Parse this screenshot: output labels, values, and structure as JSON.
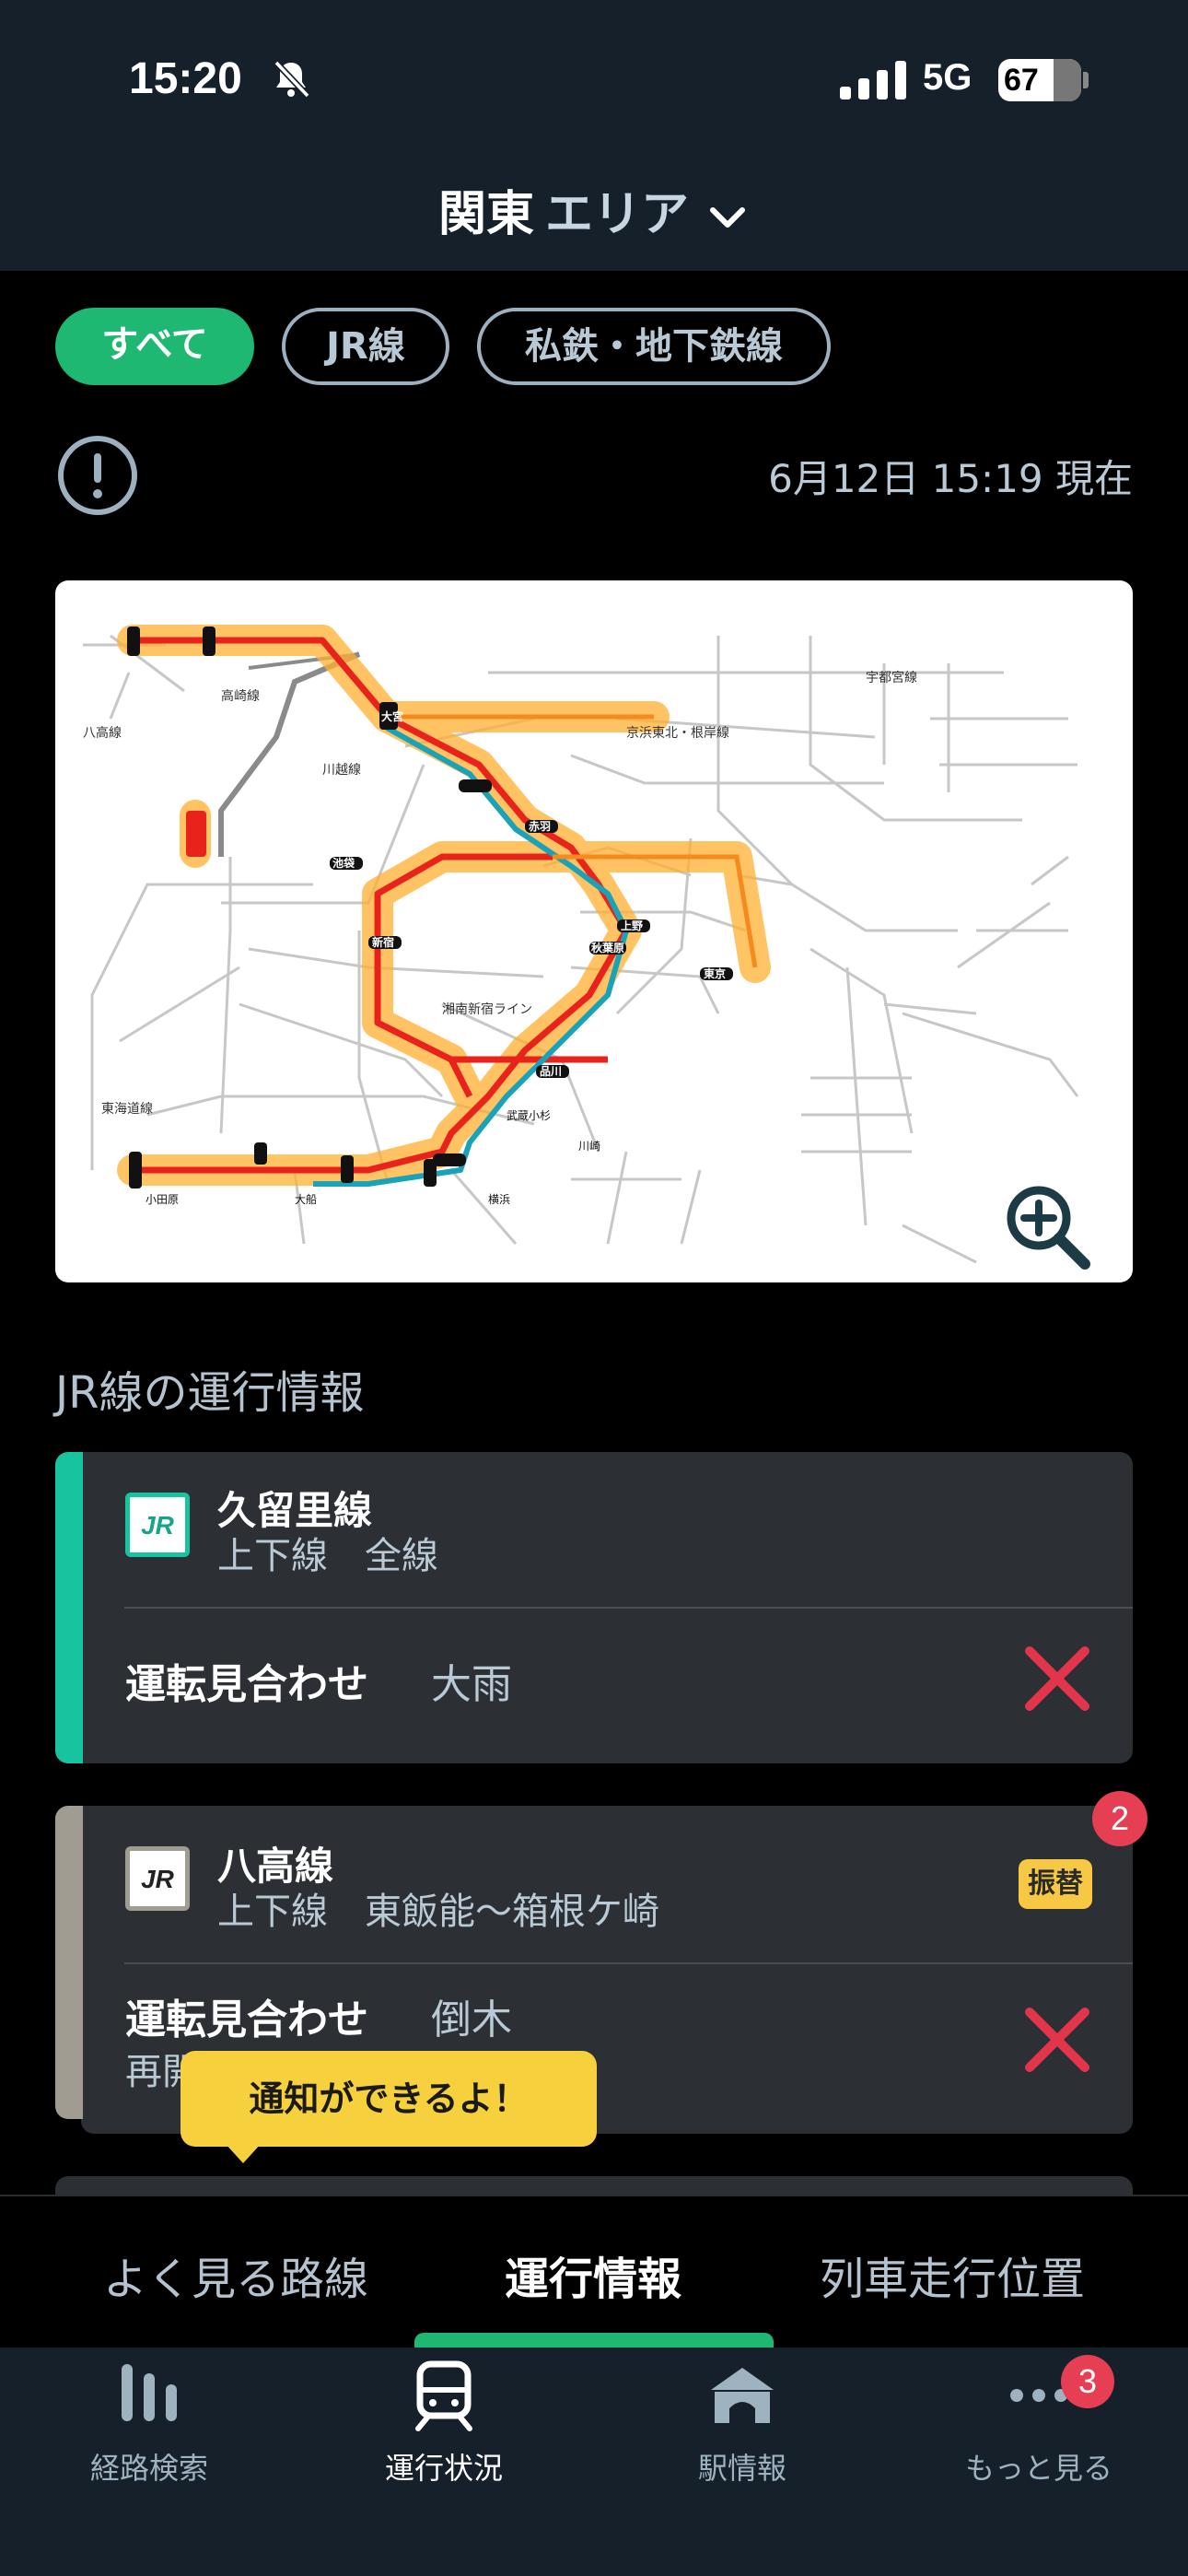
{
  "status_bar": {
    "time": "15:20",
    "network": "5G",
    "battery": "67"
  },
  "header": {
    "area_name": "関東",
    "area_suffix": "エリア"
  },
  "filters": {
    "all": "すべて",
    "jr": "JR線",
    "private": "私鉄・地下鉄線"
  },
  "update_time": "6月12日 15:19 現在",
  "section_title": "JR線の運行情報",
  "cards": [
    {
      "line": "久留里線",
      "scope": "上下線　全線",
      "status": "運転見合わせ",
      "reason": "大雨",
      "bar_color": "#18c4a0"
    },
    {
      "line": "八高線",
      "scope": "上下線　東飯能～箱根ケ崎",
      "status": "運転見合わせ",
      "reason": "倒木",
      "extra": "再開",
      "tag": "振替",
      "badge": "2",
      "bar_color": "#a19c92"
    }
  ],
  "jr_logo": "JR",
  "tooltip": "通知ができるよ！",
  "tabs": {
    "favorite": "よく見る路線",
    "info": "運行情報",
    "position": "列車走行位置"
  },
  "nav": {
    "route": "経路検索",
    "status": "運行状況",
    "station": "駅情報",
    "more": "もっと見る",
    "more_badge": "3"
  },
  "map": {
    "labels": {
      "hachiko": "八高線",
      "takasaki": "高崎線",
      "kawagoe": "川越線",
      "keihin": "京浜東北・根岸線",
      "utsunomiya": "宇都宮線",
      "shonan": "湘南新宿ライン",
      "tokaido": "東海道線",
      "omiya": "大宮",
      "akabane": "赤羽",
      "ikebukuro": "池袋",
      "shinjuku": "新宿",
      "ueno": "上野",
      "akihabara": "秋葉原",
      "tokyo": "東京",
      "shinagawa": "品川",
      "musashikosugi": "武蔵小杉",
      "kawasaki": "川崎",
      "yokohama": "横浜",
      "ofuna": "大船",
      "odawara": "小田原"
    },
    "colors": {
      "affected_line": "#e8231c",
      "glow": "#ffb030",
      "keihin_line": "#1aa3b8",
      "normal_line": "#c7c7c7"
    }
  }
}
